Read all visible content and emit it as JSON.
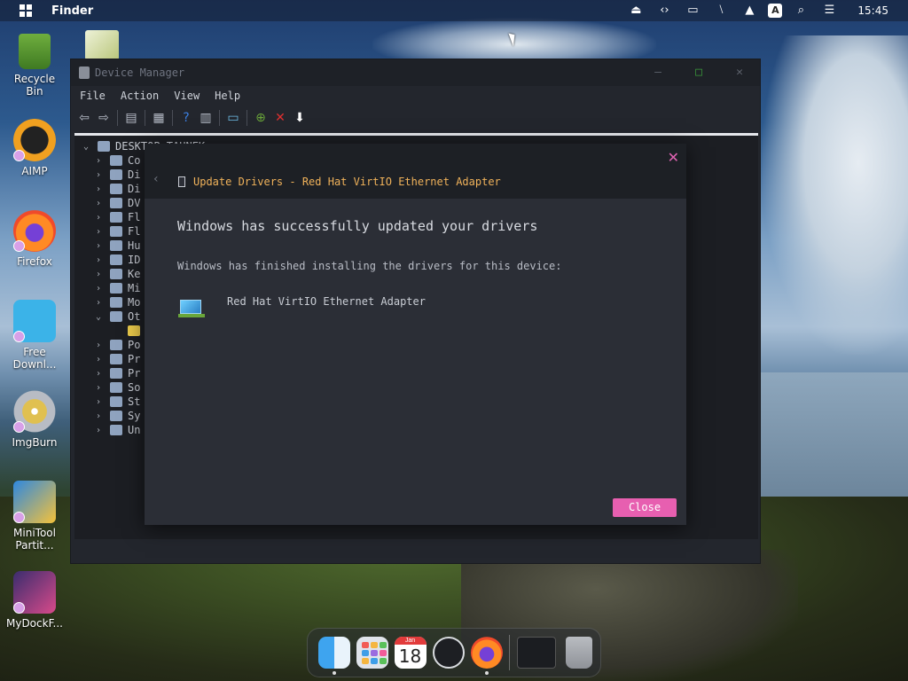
{
  "topbar": {
    "app_name": "Finder",
    "clock": "15:45",
    "tray_icons": [
      "eject-icon",
      "code-icon",
      "monitor-icon",
      "network-off-icon",
      "upload-icon",
      "input-method-icon",
      "search-icon",
      "toggle-icon"
    ],
    "input_method_label": "A"
  },
  "desktop_icons": [
    {
      "label": "Recycle\nBin",
      "icon": "recycle-bin-icon"
    },
    {
      "label": "AIMP",
      "icon": "aimp-icon"
    },
    {
      "label": "Firefox",
      "icon": "firefox-icon"
    },
    {
      "label": "Free\nDownl...",
      "icon": "free-download-icon"
    },
    {
      "label": "ImgBurn",
      "icon": "imgburn-icon"
    },
    {
      "label": "MiniTool\nPartit...",
      "icon": "minitool-icon"
    },
    {
      "label": "MyDockF...",
      "icon": "mydock-icon"
    }
  ],
  "device_manager": {
    "title": "Device Manager",
    "menu": [
      "File",
      "Action",
      "View",
      "Help"
    ],
    "root_node": "DESKTOP-TAUNEK",
    "tree_items": [
      "Co",
      "Di",
      "Di",
      "DV",
      "Fl",
      "Fl",
      "Hu",
      "ID",
      "Ke",
      "Mi",
      "Mo",
      "Ot",
      "",
      "Po",
      "Pr",
      "Pr",
      "So",
      "St",
      "Sy",
      "Un"
    ]
  },
  "dialog": {
    "title": "Update Drivers - Red Hat VirtIO Ethernet Adapter",
    "heading": "Windows has successfully updated your drivers",
    "message": "Windows has finished installing the drivers for this device:",
    "device_name": "Red Hat VirtIO Ethernet Adapter",
    "close_label": "Close",
    "accent": "#e75fb0",
    "title_color": "#f0b25a"
  },
  "dock": {
    "calendar_month": "Jan",
    "calendar_day": "18",
    "items": [
      "finder-icon",
      "launchpad-icon",
      "calendar-icon",
      "clock-icon",
      "firefox-icon",
      "window-thumbnail",
      "trash-icon"
    ]
  }
}
